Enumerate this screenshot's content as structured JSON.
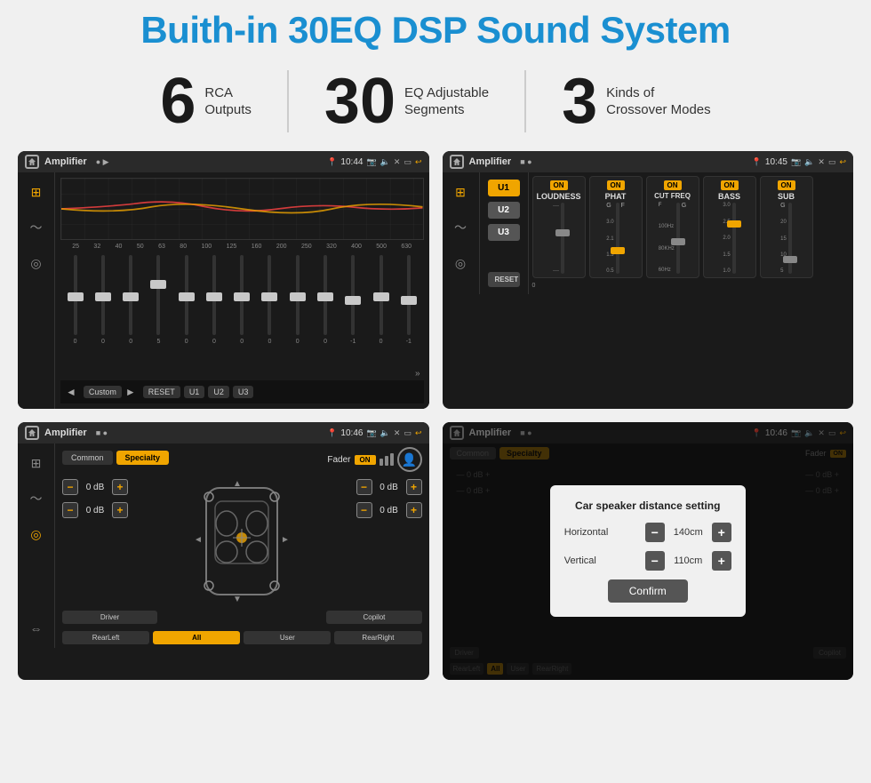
{
  "page": {
    "title": "Buith-in 30EQ DSP Sound System",
    "background": "#f0f0f0"
  },
  "stats": [
    {
      "number": "6",
      "text": "RCA\nOutputs"
    },
    {
      "number": "30",
      "text": "EQ Adjustable\nSegments"
    },
    {
      "number": "3",
      "text": "Kinds of\nCrossover Modes"
    }
  ],
  "screens": [
    {
      "id": "eq-screen",
      "statusBar": {
        "appTitle": "Amplifier",
        "time": "10:44"
      },
      "type": "equalizer",
      "freqLabels": [
        "25",
        "32",
        "40",
        "50",
        "63",
        "80",
        "100",
        "125",
        "160",
        "200",
        "250",
        "320",
        "400",
        "500",
        "630"
      ],
      "sliderValues": [
        "0",
        "0",
        "0",
        "5",
        "0",
        "0",
        "0",
        "0",
        "0",
        "0",
        "-1",
        "0",
        "-1"
      ],
      "bottomButtons": [
        "Custom",
        "RESET",
        "U1",
        "U2",
        "U3"
      ]
    },
    {
      "id": "crossover-screen",
      "statusBar": {
        "appTitle": "Amplifier",
        "time": "10:45"
      },
      "type": "crossover",
      "uButtons": [
        "U1",
        "U2",
        "U3"
      ],
      "modules": [
        {
          "name": "LOUDNESS",
          "on": true
        },
        {
          "name": "PHAT",
          "on": true
        },
        {
          "name": "CUT FREQ",
          "on": true
        },
        {
          "name": "BASS",
          "on": true
        },
        {
          "name": "SUB",
          "on": true
        }
      ],
      "resetButton": "RESET"
    },
    {
      "id": "fader-screen",
      "statusBar": {
        "appTitle": "Amplifier",
        "time": "10:46"
      },
      "type": "fader",
      "tabs": [
        "Common",
        "Specialty"
      ],
      "activeTab": "Specialty",
      "faderLabel": "Fader",
      "faderOn": "ON",
      "dbValues": [
        "0 dB",
        "0 dB",
        "0 dB",
        "0 dB"
      ],
      "bottomButtons": [
        "Driver",
        "",
        "Copilot",
        "RearLeft",
        "All",
        "User",
        "RearRight"
      ]
    },
    {
      "id": "dialog-screen",
      "statusBar": {
        "appTitle": "Amplifier",
        "time": "10:46"
      },
      "type": "fader-dialog",
      "tabs": [
        "Common",
        "Specialty"
      ],
      "dialog": {
        "title": "Car speaker distance setting",
        "fields": [
          {
            "label": "Horizontal",
            "value": "140cm"
          },
          {
            "label": "Vertical",
            "value": "110cm"
          }
        ],
        "confirmLabel": "Confirm"
      }
    }
  ]
}
